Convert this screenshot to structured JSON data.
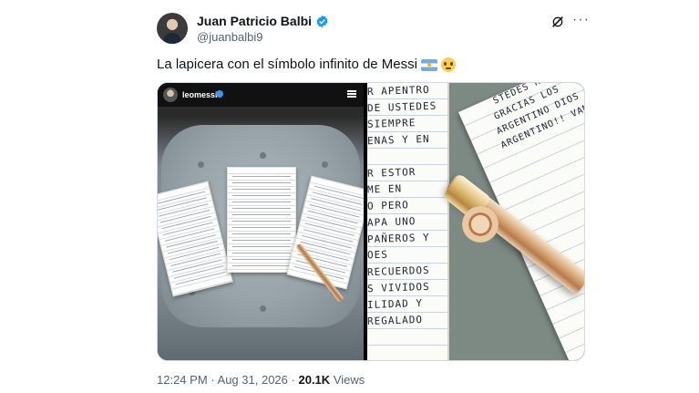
{
  "author": {
    "display_name": "Juan Patricio Balbi",
    "handle": "@juanbalbi9",
    "verified": true,
    "avatar": "profile-photo"
  },
  "header_actions": {
    "grok_icon": "grok-icon",
    "more_icon": "more-icon",
    "more_label": "···"
  },
  "tweet": {
    "text": "La lapicera con el símbolo infinito de Messi",
    "emojis": [
      "argentina-flag",
      "pleading-face"
    ]
  },
  "media": {
    "left_photo": {
      "ig_username": "leomessi",
      "ig_verified": true,
      "description_icon": "notebook-pages-on-cushion"
    },
    "right_photo": {
      "left_page_lines": [
        "R APENTRO",
        "DE USTEDES",
        "SIEMPRE",
        "ENAS Y EN",
        "",
        "R ESTOR",
        "ME EN",
        "O PERO",
        "APA UNO",
        "PAÑEROS Y",
        "OES",
        "RECUERDOS",
        "S VIVIDOS",
        "ILIDAD Y",
        "REGALADO"
      ],
      "right_page_lines": [
        "STEDES HABE",
        "GRACIAS LOS",
        "ARGENTINO DIOS",
        "ARGENTINO!! VAM"
      ]
    }
  },
  "meta": {
    "time": "12:24 PM",
    "separator": "·",
    "date": "Aug 31, 2026",
    "views_count": "20.1K",
    "views_label": "Views"
  },
  "colors": {
    "text": "#0f1419",
    "secondary": "#536471",
    "verified_blue": "#1d9bf0",
    "border": "#cfd9de"
  }
}
